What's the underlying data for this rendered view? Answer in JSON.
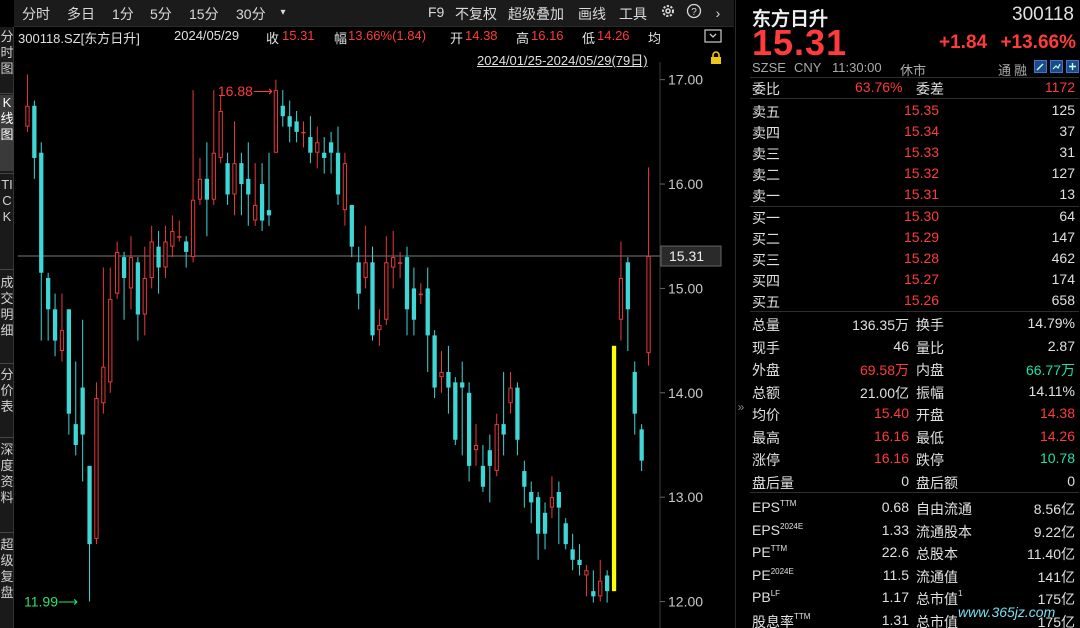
{
  "vtabs": [
    "分时图",
    "K线图",
    "TICK",
    "成交明细",
    "分价表",
    "深度资料",
    "超级复盘"
  ],
  "toolbar": {
    "periods": [
      "分时",
      "多日",
      "1分",
      "5分",
      "15分",
      "30分"
    ],
    "f9": "F9",
    "adj": "不复权",
    "overlay": "超级叠加",
    "draw": "画线",
    "tools": "工具"
  },
  "info": {
    "code": "300118.SZ[东方日升]",
    "date": "2024/05/29",
    "close_label": "收",
    "close": "15.31",
    "amp_label": "幅",
    "amp": "13.66%(1.84)",
    "open_label": "开",
    "open": "14.38",
    "high_label": "高",
    "high": "16.16",
    "low_label": "低",
    "low": "14.26",
    "avg_label": "均"
  },
  "range": "2024/01/25-2024/05/29(79日)",
  "chart_data": {
    "type": "candlestick",
    "ylim": [
      11.9,
      17.15
    ],
    "yticks": [
      "17.00",
      "16.00",
      "15.00",
      "14.00",
      "13.00",
      "12.00"
    ],
    "current_price": "15.31",
    "max_label": "16.88",
    "min_label": "11.99",
    "up_color": "#e8383a",
    "down_color": "#3fd6d6",
    "highlight_color": "#ffff00",
    "candles": [
      {
        "o": 16.55,
        "c": 16.75,
        "h": 17.05,
        "l": 16.5
      },
      {
        "o": 16.75,
        "c": 16.25,
        "h": 16.8,
        "l": 16.05
      },
      {
        "o": 16.3,
        "c": 15.15,
        "h": 16.4,
        "l": 14.5
      },
      {
        "o": 15.1,
        "c": 14.8,
        "h": 15.15,
        "l": 14.5
      },
      {
        "o": 14.8,
        "c": 14.5,
        "h": 14.95,
        "l": 14.35
      },
      {
        "o": 14.4,
        "c": 14.6,
        "h": 14.95,
        "l": 14.3
      },
      {
        "o": 14.8,
        "c": 13.8,
        "h": 14.8,
        "l": 13.6
      },
      {
        "o": 13.7,
        "c": 13.5,
        "h": 14.3,
        "l": 13.4
      },
      {
        "o": 14.05,
        "c": 13.6,
        "h": 14.7,
        "l": 13.15
      },
      {
        "o": 13.3,
        "c": 12.55,
        "h": 13.3,
        "l": 12.0
      },
      {
        "o": 12.6,
        "c": 13.95,
        "h": 14.1,
        "l": 12.55
      },
      {
        "o": 13.9,
        "c": 14.25,
        "h": 15.2,
        "l": 13.8
      },
      {
        "o": 14.1,
        "c": 14.9,
        "h": 15.2,
        "l": 14.0
      },
      {
        "o": 14.95,
        "c": 15.35,
        "h": 15.45,
        "l": 14.9
      },
      {
        "o": 15.3,
        "c": 15.1,
        "h": 15.35,
        "l": 14.7
      },
      {
        "o": 15.0,
        "c": 15.3,
        "h": 15.5,
        "l": 14.8
      },
      {
        "o": 15.25,
        "c": 14.75,
        "h": 15.3,
        "l": 14.5
      },
      {
        "o": 14.75,
        "c": 15.1,
        "h": 15.4,
        "l": 14.55
      },
      {
        "o": 15.1,
        "c": 15.45,
        "h": 15.6,
        "l": 15.0
      },
      {
        "o": 15.4,
        "c": 15.2,
        "h": 15.55,
        "l": 14.95
      },
      {
        "o": 15.2,
        "c": 15.45,
        "h": 15.6,
        "l": 15.1
      },
      {
        "o": 15.4,
        "c": 15.55,
        "h": 15.7,
        "l": 15.3
      },
      {
        "o": 15.5,
        "c": 15.5,
        "h": 15.65,
        "l": 15.45
      },
      {
        "o": 15.45,
        "c": 15.35,
        "h": 15.5,
        "l": 15.2
      },
      {
        "o": 15.3,
        "c": 15.85,
        "h": 16.9,
        "l": 15.25
      },
      {
        "o": 15.85,
        "c": 16.05,
        "h": 16.25,
        "l": 15.8
      },
      {
        "o": 16.05,
        "c": 15.85,
        "h": 16.4,
        "l": 15.5
      },
      {
        "o": 15.85,
        "c": 16.3,
        "h": 16.9,
        "l": 15.8
      },
      {
        "o": 16.25,
        "c": 16.7,
        "h": 16.85,
        "l": 16.2
      },
      {
        "o": 16.2,
        "c": 15.9,
        "h": 16.3,
        "l": 15.8
      },
      {
        "o": 15.9,
        "c": 16.2,
        "h": 16.6,
        "l": 15.7
      },
      {
        "o": 16.2,
        "c": 16.0,
        "h": 16.3,
        "l": 15.7
      },
      {
        "o": 16.05,
        "c": 15.9,
        "h": 16.4,
        "l": 15.6
      },
      {
        "o": 15.65,
        "c": 15.8,
        "h": 16.2,
        "l": 15.6
      },
      {
        "o": 16.0,
        "c": 15.65,
        "h": 16.2,
        "l": 15.55
      },
      {
        "o": 15.75,
        "c": 15.7,
        "h": 16.3,
        "l": 15.6
      },
      {
        "o": 16.3,
        "c": 16.9,
        "h": 17.0,
        "l": 16.3
      },
      {
        "o": 16.75,
        "c": 16.65,
        "h": 16.9,
        "l": 16.55
      },
      {
        "o": 16.65,
        "c": 16.55,
        "h": 16.8,
        "l": 16.4
      },
      {
        "o": 16.6,
        "c": 16.5,
        "h": 16.7,
        "l": 16.4
      },
      {
        "o": 16.5,
        "c": 16.5,
        "h": 16.6,
        "l": 16.35
      },
      {
        "o": 16.45,
        "c": 16.3,
        "h": 16.65,
        "l": 16.2
      },
      {
        "o": 16.3,
        "c": 16.4,
        "h": 16.55,
        "l": 16.15
      },
      {
        "o": 16.3,
        "c": 16.25,
        "h": 16.45,
        "l": 16.1
      },
      {
        "o": 16.4,
        "c": 16.3,
        "h": 16.5,
        "l": 16.1
      },
      {
        "o": 16.3,
        "c": 15.9,
        "h": 16.55,
        "l": 15.8
      },
      {
        "o": 15.75,
        "c": 16.2,
        "h": 16.3,
        "l": 15.6
      },
      {
        "o": 15.8,
        "c": 15.4,
        "h": 15.8,
        "l": 15.3
      },
      {
        "o": 15.25,
        "c": 14.95,
        "h": 15.4,
        "l": 14.8
      },
      {
        "o": 15.1,
        "c": 15.25,
        "h": 15.6,
        "l": 15.0
      },
      {
        "o": 15.25,
        "c": 14.55,
        "h": 15.4,
        "l": 14.5
      },
      {
        "o": 14.6,
        "c": 14.65,
        "h": 14.8,
        "l": 14.45
      },
      {
        "o": 14.7,
        "c": 15.25,
        "h": 15.5,
        "l": 14.65
      },
      {
        "o": 15.2,
        "c": 15.3,
        "h": 15.55,
        "l": 15.0
      },
      {
        "o": 15.25,
        "c": 15.25,
        "h": 15.35,
        "l": 15.1
      },
      {
        "o": 15.3,
        "c": 14.8,
        "h": 15.4,
        "l": 14.55
      },
      {
        "o": 15.0,
        "c": 14.7,
        "h": 15.2,
        "l": 14.55
      },
      {
        "o": 14.95,
        "c": 14.95,
        "h": 15.05,
        "l": 14.85
      },
      {
        "o": 15.0,
        "c": 14.55,
        "h": 15.2,
        "l": 14.2
      },
      {
        "o": 14.55,
        "c": 14.05,
        "h": 14.6,
        "l": 13.95
      },
      {
        "o": 14.15,
        "c": 14.2,
        "h": 14.4,
        "l": 14.0
      },
      {
        "o": 14.2,
        "c": 14.05,
        "h": 14.45,
        "l": 13.8
      },
      {
        "o": 14.1,
        "c": 13.55,
        "h": 14.15,
        "l": 13.5
      },
      {
        "o": 14.1,
        "c": 14.05,
        "h": 14.3,
        "l": 13.4
      },
      {
        "o": 14.0,
        "c": 13.3,
        "h": 14.1,
        "l": 13.15
      },
      {
        "o": 13.45,
        "c": 13.5,
        "h": 13.7,
        "l": 13.3
      },
      {
        "o": 13.3,
        "c": 13.1,
        "h": 13.5,
        "l": 13.05
      },
      {
        "o": 13.45,
        "c": 13.3,
        "h": 13.6,
        "l": 12.95
      },
      {
        "o": 13.25,
        "c": 13.7,
        "h": 13.8,
        "l": 13.2
      },
      {
        "o": 13.7,
        "c": 13.6,
        "h": 14.2,
        "l": 13.4
      },
      {
        "o": 13.9,
        "c": 14.05,
        "h": 14.2,
        "l": 13.8
      },
      {
        "o": 14.05,
        "c": 13.55,
        "h": 14.1,
        "l": 13.4
      },
      {
        "o": 13.25,
        "c": 13.1,
        "h": 13.35,
        "l": 12.9
      },
      {
        "o": 13.05,
        "c": 12.95,
        "h": 13.15,
        "l": 12.75
      },
      {
        "o": 13.0,
        "c": 12.65,
        "h": 13.05,
        "l": 12.4
      },
      {
        "o": 12.85,
        "c": 12.65,
        "h": 12.95,
        "l": 12.5
      },
      {
        "o": 12.9,
        "c": 13.0,
        "h": 13.2,
        "l": 12.8
      },
      {
        "o": 13.05,
        "c": 12.9,
        "h": 13.15,
        "l": 12.55
      },
      {
        "o": 12.75,
        "c": 12.55,
        "h": 12.8,
        "l": 12.5
      },
      {
        "o": 12.5,
        "c": 12.4,
        "h": 12.65,
        "l": 12.3
      },
      {
        "o": 12.4,
        "c": 12.35,
        "h": 12.55,
        "l": 12.25
      },
      {
        "o": 12.25,
        "c": 12.3,
        "h": 12.35,
        "l": 12.05
      },
      {
        "o": 12.1,
        "c": 12.05,
        "h": 12.3,
        "l": 11.99
      },
      {
        "o": 12.05,
        "c": 12.2,
        "h": 12.4,
        "l": 12.0
      },
      {
        "o": 12.25,
        "c": 12.1,
        "h": 12.3,
        "l": 11.99
      },
      {
        "o": 12.1,
        "c": 14.45,
        "h": 14.45,
        "l": 12.1,
        "hl": true
      },
      {
        "o": 14.7,
        "c": 15.1,
        "h": 15.45,
        "l": 14.5
      },
      {
        "o": 15.25,
        "c": 14.8,
        "h": 15.3,
        "l": 14.4
      },
      {
        "o": 14.2,
        "c": 13.8,
        "h": 14.3,
        "l": 13.6
      },
      {
        "o": 13.65,
        "c": 13.35,
        "h": 13.7,
        "l": 13.25
      },
      {
        "o": 14.38,
        "c": 15.31,
        "h": 16.16,
        "l": 14.26
      }
    ]
  },
  "quote": {
    "name": "东方日升",
    "code": "300118",
    "price": "15.31",
    "change": "+1.84",
    "pct": "+13.66%",
    "exchange": "SZSE",
    "currency": "CNY",
    "time": "11:30:00",
    "status": "休市",
    "tags": [
      "通",
      "融"
    ],
    "weibi_label": "委比",
    "weibi": "63.76%",
    "weicha_label": "委差",
    "weicha": "1172",
    "asks": [
      {
        "label": "卖五",
        "price": "15.35",
        "vol": "125"
      },
      {
        "label": "卖四",
        "price": "15.34",
        "vol": "37"
      },
      {
        "label": "卖三",
        "price": "15.33",
        "vol": "31"
      },
      {
        "label": "卖二",
        "price": "15.32",
        "vol": "127"
      },
      {
        "label": "卖一",
        "price": "15.31",
        "vol": "13"
      }
    ],
    "bids": [
      {
        "label": "买一",
        "price": "15.30",
        "vol": "64"
      },
      {
        "label": "买二",
        "price": "15.29",
        "vol": "147"
      },
      {
        "label": "买三",
        "price": "15.28",
        "vol": "462"
      },
      {
        "label": "买四",
        "price": "15.27",
        "vol": "174"
      },
      {
        "label": "买五",
        "price": "15.26",
        "vol": "658"
      }
    ],
    "stats": [
      {
        "l1": "总量",
        "v1": "136.35万",
        "c1": "white",
        "l2": "换手",
        "v2": "14.79%",
        "c2": "white"
      },
      {
        "l1": "现手",
        "v1": "46",
        "c1": "white",
        "l2": "量比",
        "v2": "2.87",
        "c2": "white"
      },
      {
        "l1": "外盘",
        "v1": "69.58万",
        "c1": "red",
        "l2": "内盘",
        "v2": "66.77万",
        "c2": "green"
      },
      {
        "l1": "总额",
        "v1": "21.00亿",
        "c1": "white",
        "l2": "振幅",
        "v2": "14.11%",
        "c2": "white"
      },
      {
        "l1": "均价",
        "v1": "15.40",
        "c1": "red",
        "l2": "开盘",
        "v2": "14.38",
        "c2": "red"
      },
      {
        "l1": "最高",
        "v1": "16.16",
        "c1": "red",
        "l2": "最低",
        "v2": "14.26",
        "c2": "red"
      },
      {
        "l1": "涨停",
        "v1": "16.16",
        "c1": "red",
        "l2": "跌停",
        "v2": "10.78",
        "c2": "green"
      },
      {
        "l1": "盘后量",
        "v1": "0",
        "c1": "white",
        "l2": "盘后额",
        "v2": "0",
        "c2": "white"
      }
    ],
    "fundamentals": [
      {
        "l1": "EPS",
        "s1": "TTM",
        "v1": "0.68",
        "l2": "自由流通",
        "s2": "",
        "v2": "8.56亿"
      },
      {
        "l1": "EPS",
        "s1": "2024E",
        "v1": "1.33",
        "l2": "流通股本",
        "s2": "",
        "v2": "9.22亿"
      },
      {
        "l1": "PE",
        "s1": "TTM",
        "v1": "22.6",
        "l2": "总股本",
        "s2": "",
        "v2": "11.40亿"
      },
      {
        "l1": "PE",
        "s1": "2024E",
        "v1": "11.5",
        "l2": "流通值",
        "s2": "",
        "v2": "141亿"
      },
      {
        "l1": "PB",
        "s1": "LF",
        "v1": "1.17",
        "l2": "总市值",
        "s2": "1",
        "v2": "175亿"
      },
      {
        "l1": "股息率",
        "s1": "TTM",
        "v1": "1.31",
        "l2": "总市值",
        "s2": "",
        "v2": "175亿"
      }
    ]
  },
  "watermark": "www.365jz.com"
}
